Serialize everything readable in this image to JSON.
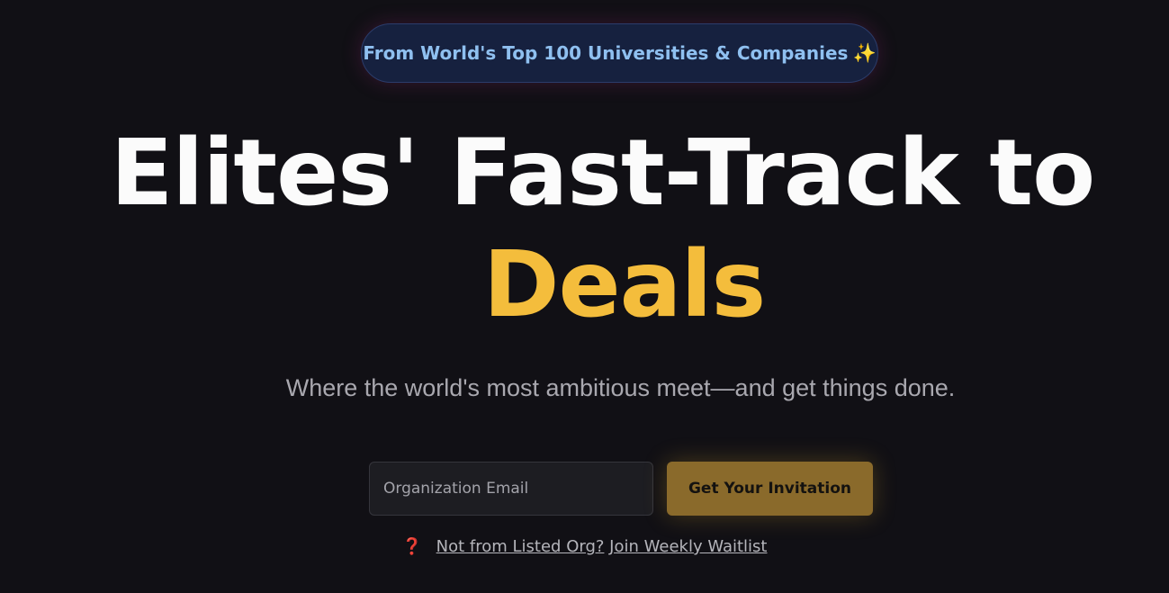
{
  "badge": {
    "text": "From World's Top 100 Universities & Companies",
    "sparkle": "✨",
    "icon": "sparkles-icon"
  },
  "hero": {
    "line1": "Elites' Fast-Track to",
    "line2": "Deals",
    "accent_color": "#f4bd3c"
  },
  "subtitle": "Where the world's most ambitious meet—and get things done.",
  "signup": {
    "email_placeholder": "Organization Email",
    "email_value": "",
    "button_label": "Get Your Invitation"
  },
  "waitlist": {
    "icon": "question-mark-icon",
    "icon_glyph": "❓",
    "link1": "Not from Listed Org?",
    "link2": "Join Weekly Waitlist"
  },
  "colors": {
    "background": "#111015",
    "badge_bg": "#16213f",
    "badge_text": "#8fc0f0",
    "button_bg": "#8a6a2b"
  }
}
